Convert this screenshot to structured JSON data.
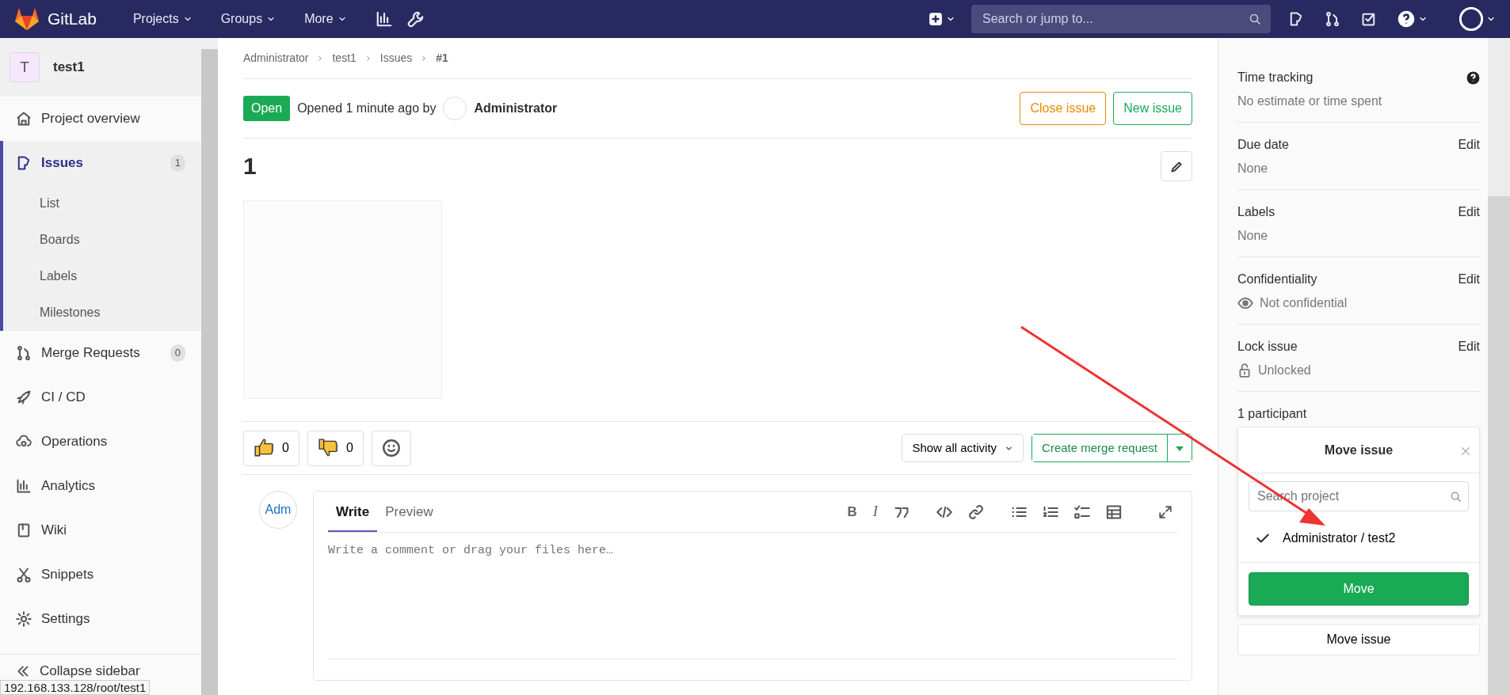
{
  "navbar": {
    "brand": "GitLab",
    "menus": [
      {
        "label": "Projects"
      },
      {
        "label": "Groups"
      },
      {
        "label": "More"
      }
    ],
    "search": {
      "placeholder": "Search or jump to..."
    }
  },
  "sidebar": {
    "project": {
      "avatar": "T",
      "name": "test1"
    },
    "items": [
      {
        "label": "Project overview",
        "selected": false
      },
      {
        "label": "Issues",
        "selected": true,
        "count": "1",
        "children": [
          {
            "label": "List"
          },
          {
            "label": "Boards"
          },
          {
            "label": "Labels"
          },
          {
            "label": "Milestones"
          }
        ]
      },
      {
        "label": "Merge Requests",
        "selected": false,
        "count": "0"
      },
      {
        "label": "CI / CD",
        "selected": false
      },
      {
        "label": "Operations",
        "selected": false
      },
      {
        "label": "Analytics",
        "selected": false
      },
      {
        "label": "Wiki",
        "selected": false
      },
      {
        "label": "Snippets",
        "selected": false
      },
      {
        "label": "Settings",
        "selected": false
      }
    ],
    "collapse": "Collapse sidebar"
  },
  "status_url": "192.168.133.128/root/test1",
  "breadcrumbs": [
    "Administrator",
    "test1",
    "Issues",
    "#1"
  ],
  "issue": {
    "status": "Open",
    "opened": "Opened 1 minute ago by",
    "author": "Administrator",
    "title": "1",
    "actions": [
      {
        "label": "Close issue",
        "kind": "warning"
      },
      {
        "label": "New issue",
        "kind": "success"
      }
    ]
  },
  "awards": [
    {
      "kind": "thumbsup",
      "count": "0"
    },
    {
      "kind": "thumbsdown",
      "count": "0"
    }
  ],
  "activity_filter": "Show all activity",
  "merge_request_button": "Create merge request",
  "comment": {
    "avatar": "Adm",
    "tabs": [
      {
        "label": "Write",
        "selected": true
      },
      {
        "label": "Preview",
        "selected": false
      }
    ],
    "toolbar": {
      "bold": "B",
      "italic": "I"
    },
    "placeholder": "Write a comment or drag your files here…"
  },
  "right_sidebar": {
    "blocks": [
      {
        "title": "Time tracking",
        "kind": "help",
        "value": "No estimate or time spent"
      },
      {
        "title": "Due date",
        "kind": "plain",
        "action": "Edit",
        "value": "None"
      },
      {
        "title": "Labels",
        "kind": "plain",
        "action": "Edit",
        "value": "None"
      },
      {
        "title": "Confidentiality",
        "kind": "eye",
        "action": "Edit",
        "value": "Not confidential"
      },
      {
        "title": "Lock issue",
        "kind": "lock",
        "action": "Edit",
        "value": "Unlocked"
      }
    ],
    "participants": "1 participant",
    "move_dropdown": {
      "title": "Move issue",
      "search_placeholder": "Search project",
      "projects": [
        {
          "label": "Administrator / test2",
          "selected": true
        }
      ],
      "submit": "Move"
    },
    "move_button": "Move issue"
  }
}
